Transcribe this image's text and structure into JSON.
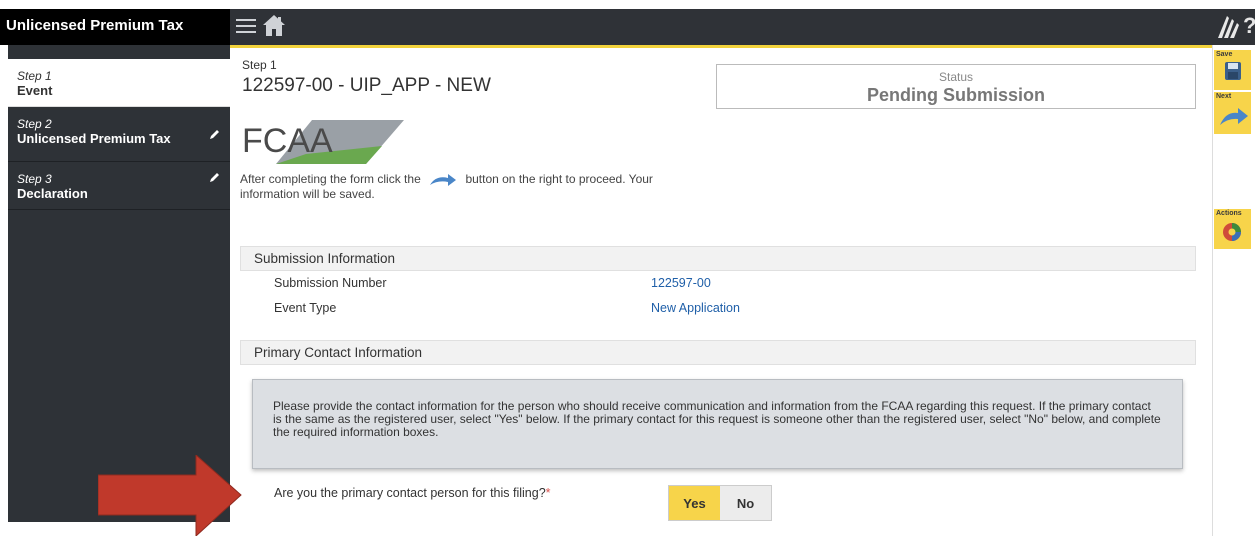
{
  "app": {
    "title": "Unlicensed Premium Tax"
  },
  "sidebar": {
    "steps": [
      {
        "num": "Step 1",
        "name": "Event"
      },
      {
        "num": "Step 2",
        "name": "Unlicensed Premium Tax"
      },
      {
        "num": "Step 3",
        "name": "Declaration"
      }
    ]
  },
  "header": {
    "step_label": "Step 1",
    "title": "122597-00 - UIP_APP - NEW",
    "status_label": "Status",
    "status_value": "Pending Submission",
    "logo_text": "FCAA"
  },
  "instructions": {
    "before": "After completing the form click the",
    "after": "button on the right to proceed. Your information will be saved."
  },
  "submission_info": {
    "heading": "Submission Information",
    "rows": [
      {
        "label": "Submission Number",
        "value": "122597-00"
      },
      {
        "label": "Event Type",
        "value": "New Application"
      }
    ]
  },
  "primary_contact": {
    "heading": "Primary Contact Information",
    "info": "Please provide the contact information for the person who should receive communication and information from the FCAA regarding this request. If the primary contact is the same as the registered user, select \"Yes\" below. If the primary contact for this request is someone other than the registered user, select \"No\" below, and complete the required information boxes.",
    "question": "Are you the primary contact person for this filing?",
    "required_mark": "*",
    "yes_label": "Yes",
    "no_label": "No",
    "selected": "Yes"
  },
  "rail": {
    "save_label": "Save",
    "next_label": "Next",
    "actions_label": "Actions"
  },
  "topbar": {
    "help_label": "?"
  },
  "colors": {
    "accent": "#f7d44a",
    "sidebar": "#2e3237",
    "topbar": "#2f3237",
    "annotation": "#c0392b",
    "link": "#1f5fa8"
  }
}
